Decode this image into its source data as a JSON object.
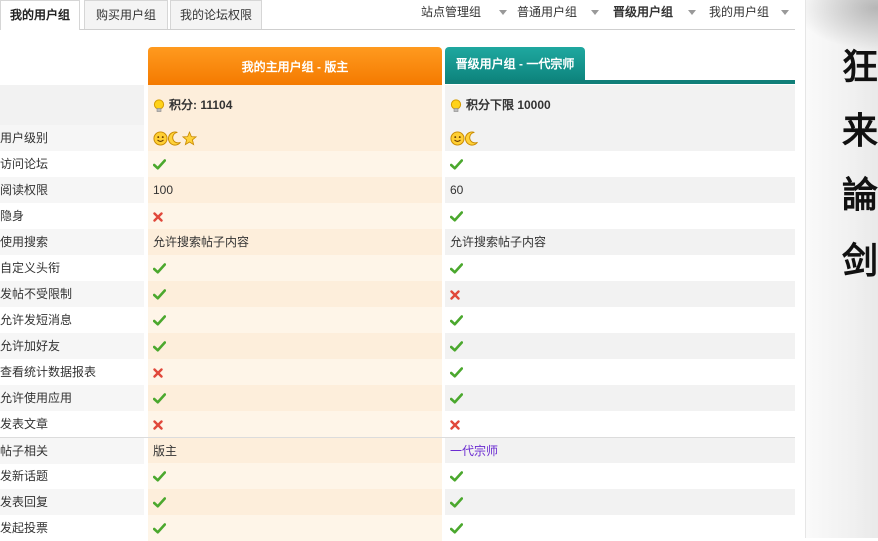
{
  "tabs_left": [
    {
      "label": "我的用户组",
      "active": true
    },
    {
      "label": "购买用户组",
      "active": false
    },
    {
      "label": "我的论坛权限",
      "active": false
    }
  ],
  "tabs_right": [
    {
      "label": "站点管理组",
      "bold": false
    },
    {
      "label": "普通用户组",
      "bold": false
    },
    {
      "label": "晋级用户组",
      "bold": true
    },
    {
      "label": "我的用户组",
      "bold": false
    }
  ],
  "columns": {
    "main_header": "我的主用户组 - 版主",
    "promo_header": "晋级用户组 - 一代宗师"
  },
  "points": {
    "main": "积分: 11104",
    "promo": "积分下限 10000"
  },
  "rows": [
    {
      "label": "用户级别",
      "main": "icons:level3",
      "promo": "icons:level2"
    },
    {
      "label": "访问论坛",
      "main": "yes",
      "promo": "yes"
    },
    {
      "label": "阅读权限",
      "main": "100",
      "promo": "60"
    },
    {
      "label": "隐身",
      "main": "no",
      "promo": "yes"
    },
    {
      "label": "使用搜索",
      "main": "允许搜索帖子内容",
      "promo": "允许搜索帖子内容"
    },
    {
      "label": "自定义头衔",
      "main": "yes",
      "promo": "yes"
    },
    {
      "label": "发帖不受限制",
      "main": "yes",
      "promo": "no"
    },
    {
      "label": "允许发短消息",
      "main": "yes",
      "promo": "yes"
    },
    {
      "label": "允许加好友",
      "main": "yes",
      "promo": "yes"
    },
    {
      "label": "查看统计数据报表",
      "main": "no",
      "promo": "yes"
    },
    {
      "label": "允许使用应用",
      "main": "yes",
      "promo": "yes"
    },
    {
      "label": "发表文章",
      "main": "no",
      "promo": "no"
    },
    {
      "label": "帖子相关",
      "main": "版主",
      "promo": "一代宗师",
      "section": true
    },
    {
      "label": "发新话题",
      "main": "yes",
      "promo": "yes"
    },
    {
      "label": "发表回复",
      "main": "yes",
      "promo": "yes"
    },
    {
      "label": "发起投票",
      "main": "yes",
      "promo": "yes"
    }
  ],
  "side_characters": [
    "狂",
    "来",
    "論",
    "剑"
  ],
  "colors": {
    "orange": "#f47a00",
    "teal": "#0e857e",
    "check": "#4ba82e",
    "cross": "#e0483b",
    "purple": "#6a2ad1"
  }
}
